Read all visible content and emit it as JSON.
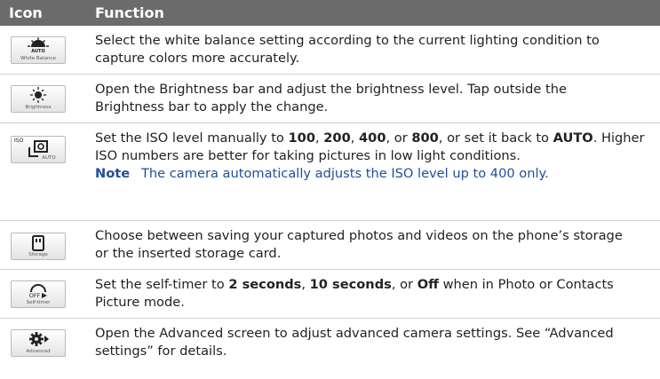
{
  "table": {
    "header": {
      "icon": "Icon",
      "function": "Function"
    },
    "rows": [
      {
        "icon_name": "white-balance-icon",
        "icon_label": "White Balance",
        "icon_badge": "AUTO",
        "lines": [
          "Select the white balance setting according to the current lighting condition to",
          "capture colors more accurately."
        ]
      },
      {
        "icon_name": "brightness-icon",
        "icon_label": "Brightness",
        "lines": [
          "Open the Brightness bar and adjust the brightness level. Tap outside the",
          "Brightness bar to apply the change."
        ]
      },
      {
        "icon_name": "iso-icon",
        "icon_badge_top": "ISO",
        "icon_label": "AUTO",
        "line1_parts": [
          "Set the ISO level manually to ",
          "100",
          ", ",
          "200",
          ", ",
          "400",
          ", or ",
          "800",
          ", or set it back to ",
          "AUTO",
          ". Higher"
        ],
        "line2": "ISO numbers are better for taking pictures in low light conditions.",
        "note_label": "Note",
        "note_text": "The camera automatically adjusts the ISO level up to 400 only."
      },
      {
        "icon_name": "storage-icon",
        "icon_label": "Storage",
        "lines": [
          "Choose between saving your captured photos and videos on the phone’s storage",
          "or the inserted storage card."
        ]
      },
      {
        "icon_name": "self-timer-icon",
        "icon_badge": "OFF",
        "icon_label": "Self-timer",
        "line1_parts": [
          "Set the self-timer to ",
          "2 seconds",
          ", ",
          "10 seconds",
          ", or ",
          "Off",
          " when in Photo or Contacts"
        ],
        "line2": "Picture mode."
      },
      {
        "icon_name": "advanced-icon",
        "icon_label": "Advanced",
        "lines": [
          "Open the Advanced screen to adjust advanced camera settings. See “Advanced",
          "settings” for details."
        ]
      }
    ]
  }
}
